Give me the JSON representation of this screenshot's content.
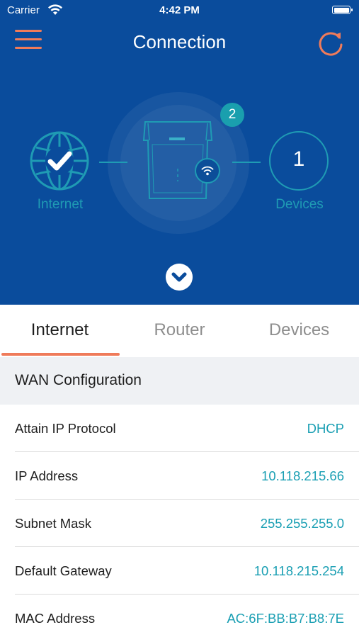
{
  "status_bar": {
    "carrier": "Carrier",
    "time": "4:42 PM"
  },
  "nav": {
    "title": "Connection",
    "menu_icon": "hamburger-menu-icon",
    "refresh_icon": "refresh-icon"
  },
  "topology": {
    "internet_label": "Internet",
    "internet_status": "connected",
    "router_badge": "2",
    "devices_count": "1",
    "devices_label": "Devices"
  },
  "tabs": [
    {
      "label": "Internet",
      "active": true
    },
    {
      "label": "Router",
      "active": false
    },
    {
      "label": "Devices",
      "active": false
    }
  ],
  "wan": {
    "title": "WAN Configuration",
    "rows": [
      {
        "label": "Attain IP Protocol",
        "value": "DHCP"
      },
      {
        "label": "IP Address",
        "value": "10.118.215.66"
      },
      {
        "label": "Subnet Mask",
        "value": "255.255.255.0"
      },
      {
        "label": "Default Gateway",
        "value": "10.118.215.254"
      },
      {
        "label": "MAC Address",
        "value": "AC:6F:BB:B7:B8:7E"
      }
    ]
  },
  "colors": {
    "hero_background": "#0a4c9c",
    "accent": "#ef7b5a",
    "teal": "#1f9bb4",
    "value_text": "#1a9fb3"
  }
}
